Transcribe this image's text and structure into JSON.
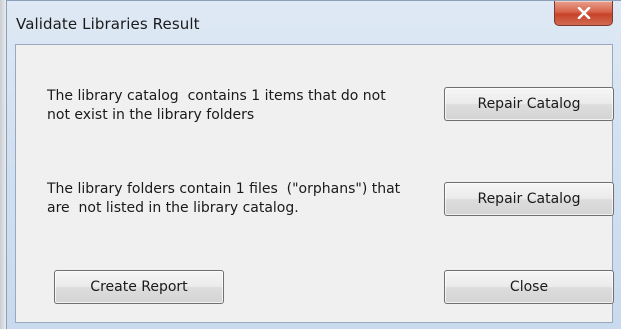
{
  "window": {
    "title": "Validate Libraries Result",
    "close_icon": "close-icon"
  },
  "catalog_section": {
    "message": "The library catalog  contains 1 items that do not\nnot exist in the library folders",
    "button_label": "Repair Catalog"
  },
  "folders_section": {
    "message": "The library folders contain 1 files  (\"orphans\") that\nare  not listed in the library catalog.",
    "button_label": "Repair Catalog"
  },
  "footer": {
    "create_report_label": "Create Report",
    "close_label": "Close"
  },
  "colors": {
    "title_close_red": "#c7442a",
    "frame_blue": "#d3e1f1",
    "client_bg": "#f0f0f0"
  }
}
